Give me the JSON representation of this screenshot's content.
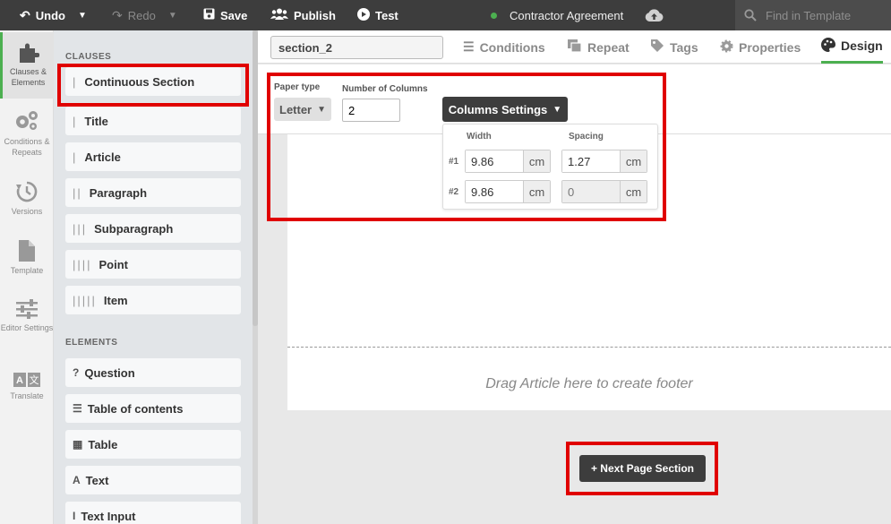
{
  "toolbar": {
    "undo": "Undo",
    "redo": "Redo",
    "save": "Save",
    "publish": "Publish",
    "test": "Test",
    "document_title": "Contractor Agreement",
    "search_placeholder": "Find in Template"
  },
  "rail": {
    "items": [
      {
        "label": "Clauses & Elements",
        "icon": "puzzle-icon",
        "active": true
      },
      {
        "label": "Conditions & Repeats",
        "icon": "gears-icon"
      },
      {
        "label": "Versions",
        "icon": "history-icon"
      },
      {
        "label": "Template",
        "icon": "file-icon"
      },
      {
        "label": "Editor Settings",
        "icon": "sliders-icon"
      },
      {
        "label": "Translate",
        "icon": "translate-icon"
      }
    ]
  },
  "palette": {
    "clauses_heading": "CLAUSES",
    "clauses": [
      {
        "bars": "|",
        "label": "Continuous Section"
      },
      {
        "bars": "|",
        "label": "Title"
      },
      {
        "bars": "|",
        "label": "Article"
      },
      {
        "bars": "||",
        "label": "Paragraph"
      },
      {
        "bars": "|||",
        "label": "Subparagraph"
      },
      {
        "bars": "||||",
        "label": "Point"
      },
      {
        "bars": "|||||",
        "label": "Item"
      }
    ],
    "elements_heading": "ELEMENTS",
    "elements": [
      {
        "glyph": "?",
        "label": "Question"
      },
      {
        "glyph": "☰",
        "label": "Table of contents"
      },
      {
        "glyph": "▦",
        "label": "Table"
      },
      {
        "glyph": "A",
        "label": "Text"
      },
      {
        "glyph": "I",
        "label": "Text Input"
      }
    ]
  },
  "tabs": {
    "section_name": "section_2",
    "items": [
      {
        "label": "Conditions",
        "icon": "list-icon"
      },
      {
        "label": "Repeat",
        "icon": "repeat-icon"
      },
      {
        "label": "Tags",
        "icon": "tag-icon"
      },
      {
        "label": "Properties",
        "icon": "gear-icon"
      },
      {
        "label": "Design",
        "icon": "palette-icon",
        "active": true
      }
    ]
  },
  "design": {
    "paper_type_label": "Paper type",
    "paper_type_value": "Letter",
    "num_columns_label": "Number of Columns",
    "num_columns_value": "2",
    "columns_settings_label": "Columns Settings",
    "width_label": "Width",
    "spacing_label": "Spacing",
    "columns": [
      {
        "num": "#1",
        "width": "9.86",
        "spacing": "1.27",
        "unit": "cm"
      },
      {
        "num": "#2",
        "width": "9.86",
        "spacing": "0",
        "unit": "cm"
      }
    ]
  },
  "canvas": {
    "footer_hint": "Drag Article here to create footer",
    "next_page_button": "+ Next Page Section"
  },
  "colors": {
    "accent": "#4caf50",
    "highlight": "#e00000",
    "dark": "#3d3d3d"
  }
}
